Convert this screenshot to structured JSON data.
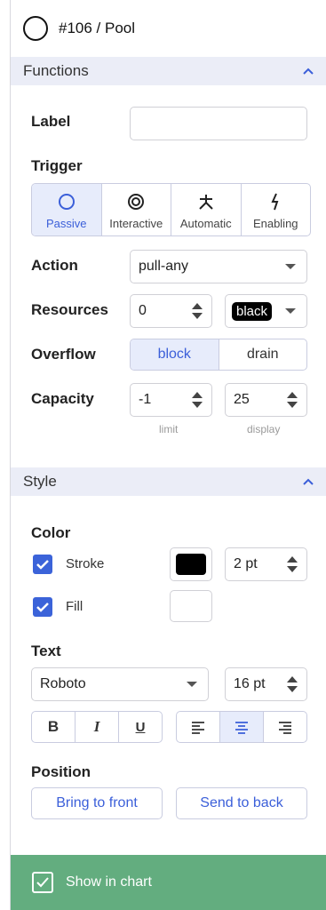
{
  "header": {
    "title": "#106 / Pool"
  },
  "functions": {
    "section_label": "Functions",
    "label_field": {
      "label": "Label",
      "value": ""
    },
    "trigger": {
      "label": "Trigger",
      "options": [
        {
          "label": "Passive",
          "icon": "circle-icon",
          "active": true
        },
        {
          "label": "Interactive",
          "icon": "target-icon",
          "active": false
        },
        {
          "label": "Automatic",
          "icon": "asterisk-icon",
          "active": false
        },
        {
          "label": "Enabling",
          "icon": "lightning-icon",
          "active": false
        }
      ]
    },
    "action": {
      "label": "Action",
      "value": "pull-any"
    },
    "resources": {
      "label": "Resources",
      "amount": "0",
      "color": "black"
    },
    "overflow": {
      "label": "Overflow",
      "options": [
        "block",
        "drain"
      ],
      "selected": "block"
    },
    "capacity": {
      "label": "Capacity",
      "limit": "-1",
      "display": "25",
      "limit_hint": "limit",
      "display_hint": "display"
    }
  },
  "style": {
    "section_label": "Style",
    "color_heading": "Color",
    "stroke": {
      "label": "Stroke",
      "checked": true,
      "color": "#000000",
      "width": "2 pt"
    },
    "fill": {
      "label": "Fill",
      "checked": true,
      "color": "#ffffff"
    },
    "text_heading": "Text",
    "font": {
      "family": "Roboto",
      "size": "16 pt"
    },
    "format": {
      "bold": "B",
      "italic": "I",
      "underline": "U"
    },
    "align_selected": "center",
    "position_heading": "Position",
    "bring_front": "Bring to front",
    "send_back": "Send to back"
  },
  "footer": {
    "label": "Show in chart",
    "checked": true
  },
  "colors": {
    "accent": "#3b5fd9",
    "section_bg": "#ebedf7",
    "footer_bg": "#63ad7f",
    "active_bg": "#e7ecfb"
  }
}
